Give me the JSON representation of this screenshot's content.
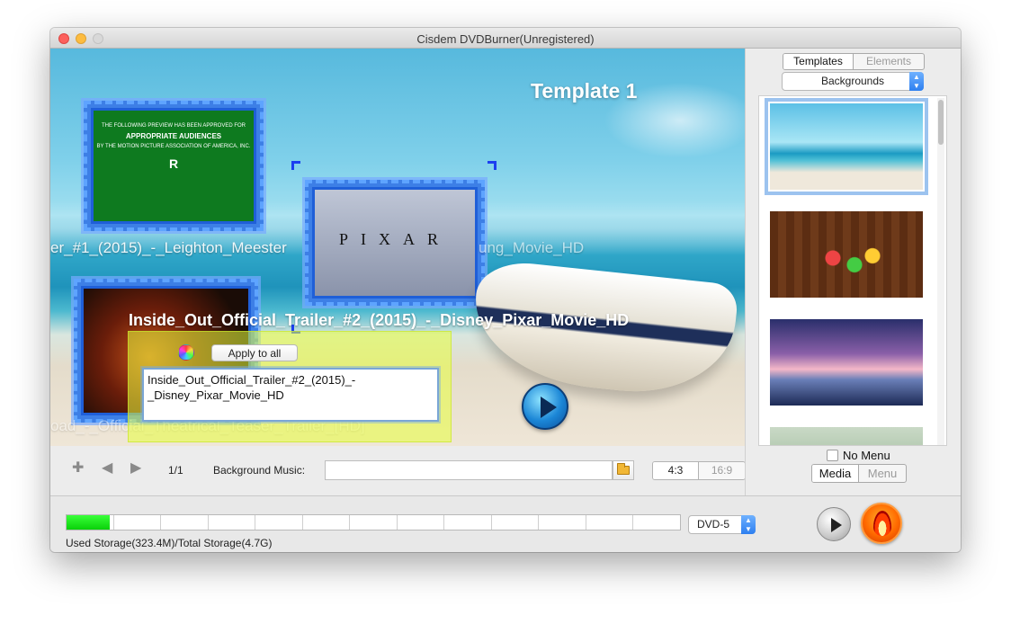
{
  "window": {
    "title": "Cisdem DVDBurner(Unregistered)"
  },
  "preview": {
    "template_title": "Template 1",
    "captions": [
      "er_#1_(2015)_-_Leighton_Meester",
      "ung_Movie_HD",
      "Inside_Out_Official_Trailer_#2_(2015)_-_Disney_Pixar_Movie_HD",
      "oad_-_Official_Theatrical_Teaser_Trailer_[HD]"
    ],
    "thumb1_text": {
      "line1": "THE FOLLOWING PREVIEW HAS BEEN APPROVED FOR",
      "line2": "APPROPRIATE AUDIENCES",
      "line3": "BY THE MOTION PICTURE ASSOCIATION OF AMERICA, INC.",
      "rating": "R"
    },
    "thumb2_text": "PIXAR",
    "editor": {
      "apply_label": "Apply to all",
      "text": "Inside_Out_Official_Trailer_#2_(2015)_-_Disney_Pixar_Movie_HD"
    }
  },
  "controls": {
    "add_icon": "plus-icon",
    "prev_icon": "arrow-left-icon",
    "next_icon": "arrow-right-icon",
    "page_count": "1/1",
    "bg_music_label": "Background Music:",
    "bg_music_value": "",
    "ratio_options": [
      "4:3",
      "16:9"
    ],
    "ratio_selected": "4:3"
  },
  "right_panel": {
    "tabs": [
      "Templates",
      "Elements"
    ],
    "tab_selected": "Templates",
    "category": "Backgrounds",
    "no_menu_label": "No Menu",
    "no_menu_checked": false,
    "mode_tabs": [
      "Media",
      "Menu"
    ],
    "mode_selected": "Media"
  },
  "storage": {
    "used_fraction": 0.07,
    "text": "Used Storage(323.4M)/Total Storage(4.7G)",
    "disc_type": "DVD-5"
  },
  "colors": {
    "storage_fill": "#0ad10a",
    "selection_bracket": "#1c3ff0",
    "accent_select": "#2d7ff0"
  }
}
